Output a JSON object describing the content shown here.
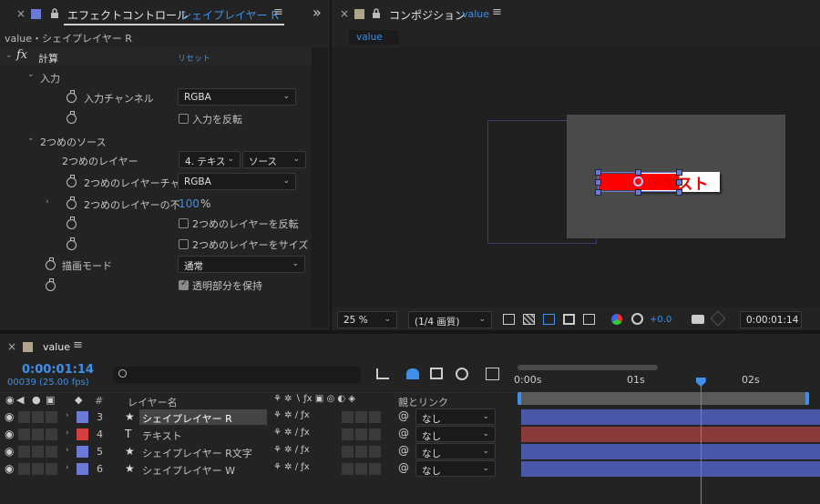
{
  "effect_panel": {
    "tab_close": "×",
    "tab_title": "エフェクトコントロール",
    "tab_layer": "シェイプレイヤー R",
    "tab_menu": "≡",
    "collapse": "»",
    "breadcrumb": "value・シェイプレイヤー R",
    "fx_label": "fx",
    "effect_name": "計算",
    "reset_label": "リセット",
    "group_input": "入力",
    "input_channel_label": "入力チャンネル",
    "input_channel_value": "RGBA",
    "invert_input_label": "入力を反転",
    "group_second": "2つめのソース",
    "second_layer_label": "2つめのレイヤー",
    "second_layer_value": "4. テキス",
    "second_layer_source": "ソース",
    "second_channel_label": "2つめのレイヤーチャ",
    "second_channel_value": "RGBA",
    "second_opacity_label": "2つめのレイヤーの不",
    "second_opacity_value": "100",
    "second_opacity_unit": "%",
    "invert_second_label": "2つめのレイヤーを反転",
    "stretch_second_label": "2つめのレイヤーをサイズ",
    "blend_mode_label": "描画モード",
    "blend_mode_value": "通常",
    "preserve_alpha_label": "透明部分を保持"
  },
  "comp_panel": {
    "tab_close": "×",
    "tab_title": "コンポジション",
    "tab_comp": "value",
    "tab_menu": "≡",
    "comp_tab": "value",
    "canvas_text": "テキスト",
    "zoom": "25 %",
    "resolution": "(1/4 画質)",
    "exposure": "+0.0",
    "timecode": "0:00:01:14"
  },
  "timeline": {
    "tab_close": "×",
    "tab_title": "value",
    "tab_menu": "≡",
    "timecode": "0:00:01:14",
    "frame_info": "00039 (25.00 fps)",
    "search_placeholder": "",
    "col_num": "#",
    "col_layer_name": "レイヤー名",
    "col_parent": "親とリンク",
    "ruler": [
      "0:00s",
      "01s",
      "02s"
    ],
    "playhead_fraction": 0.58,
    "layers": [
      {
        "num": "3",
        "type": "★",
        "name": "シェイプレイヤー R",
        "color": "#6b7ad6",
        "parent": "なし",
        "selected": true,
        "bar": "#4a57a8"
      },
      {
        "num": "4",
        "type": "T",
        "name": "テキスト",
        "color": "#d44040",
        "parent": "なし",
        "selected": false,
        "bar": "#8a3a3a"
      },
      {
        "num": "5",
        "type": "★",
        "name": "シェイプレイヤー R文字",
        "color": "#6b7ad6",
        "parent": "なし",
        "selected": false,
        "bar": "#4a57a8"
      },
      {
        "num": "6",
        "type": "★",
        "name": "シェイプレイヤー W",
        "color": "#6b7ad6",
        "parent": "なし",
        "selected": false,
        "bar": "#4a57a8"
      }
    ]
  },
  "colors": {
    "accent": "#3e90e8",
    "label_blue": "#6b7ad6",
    "label_red": "#d44040"
  }
}
